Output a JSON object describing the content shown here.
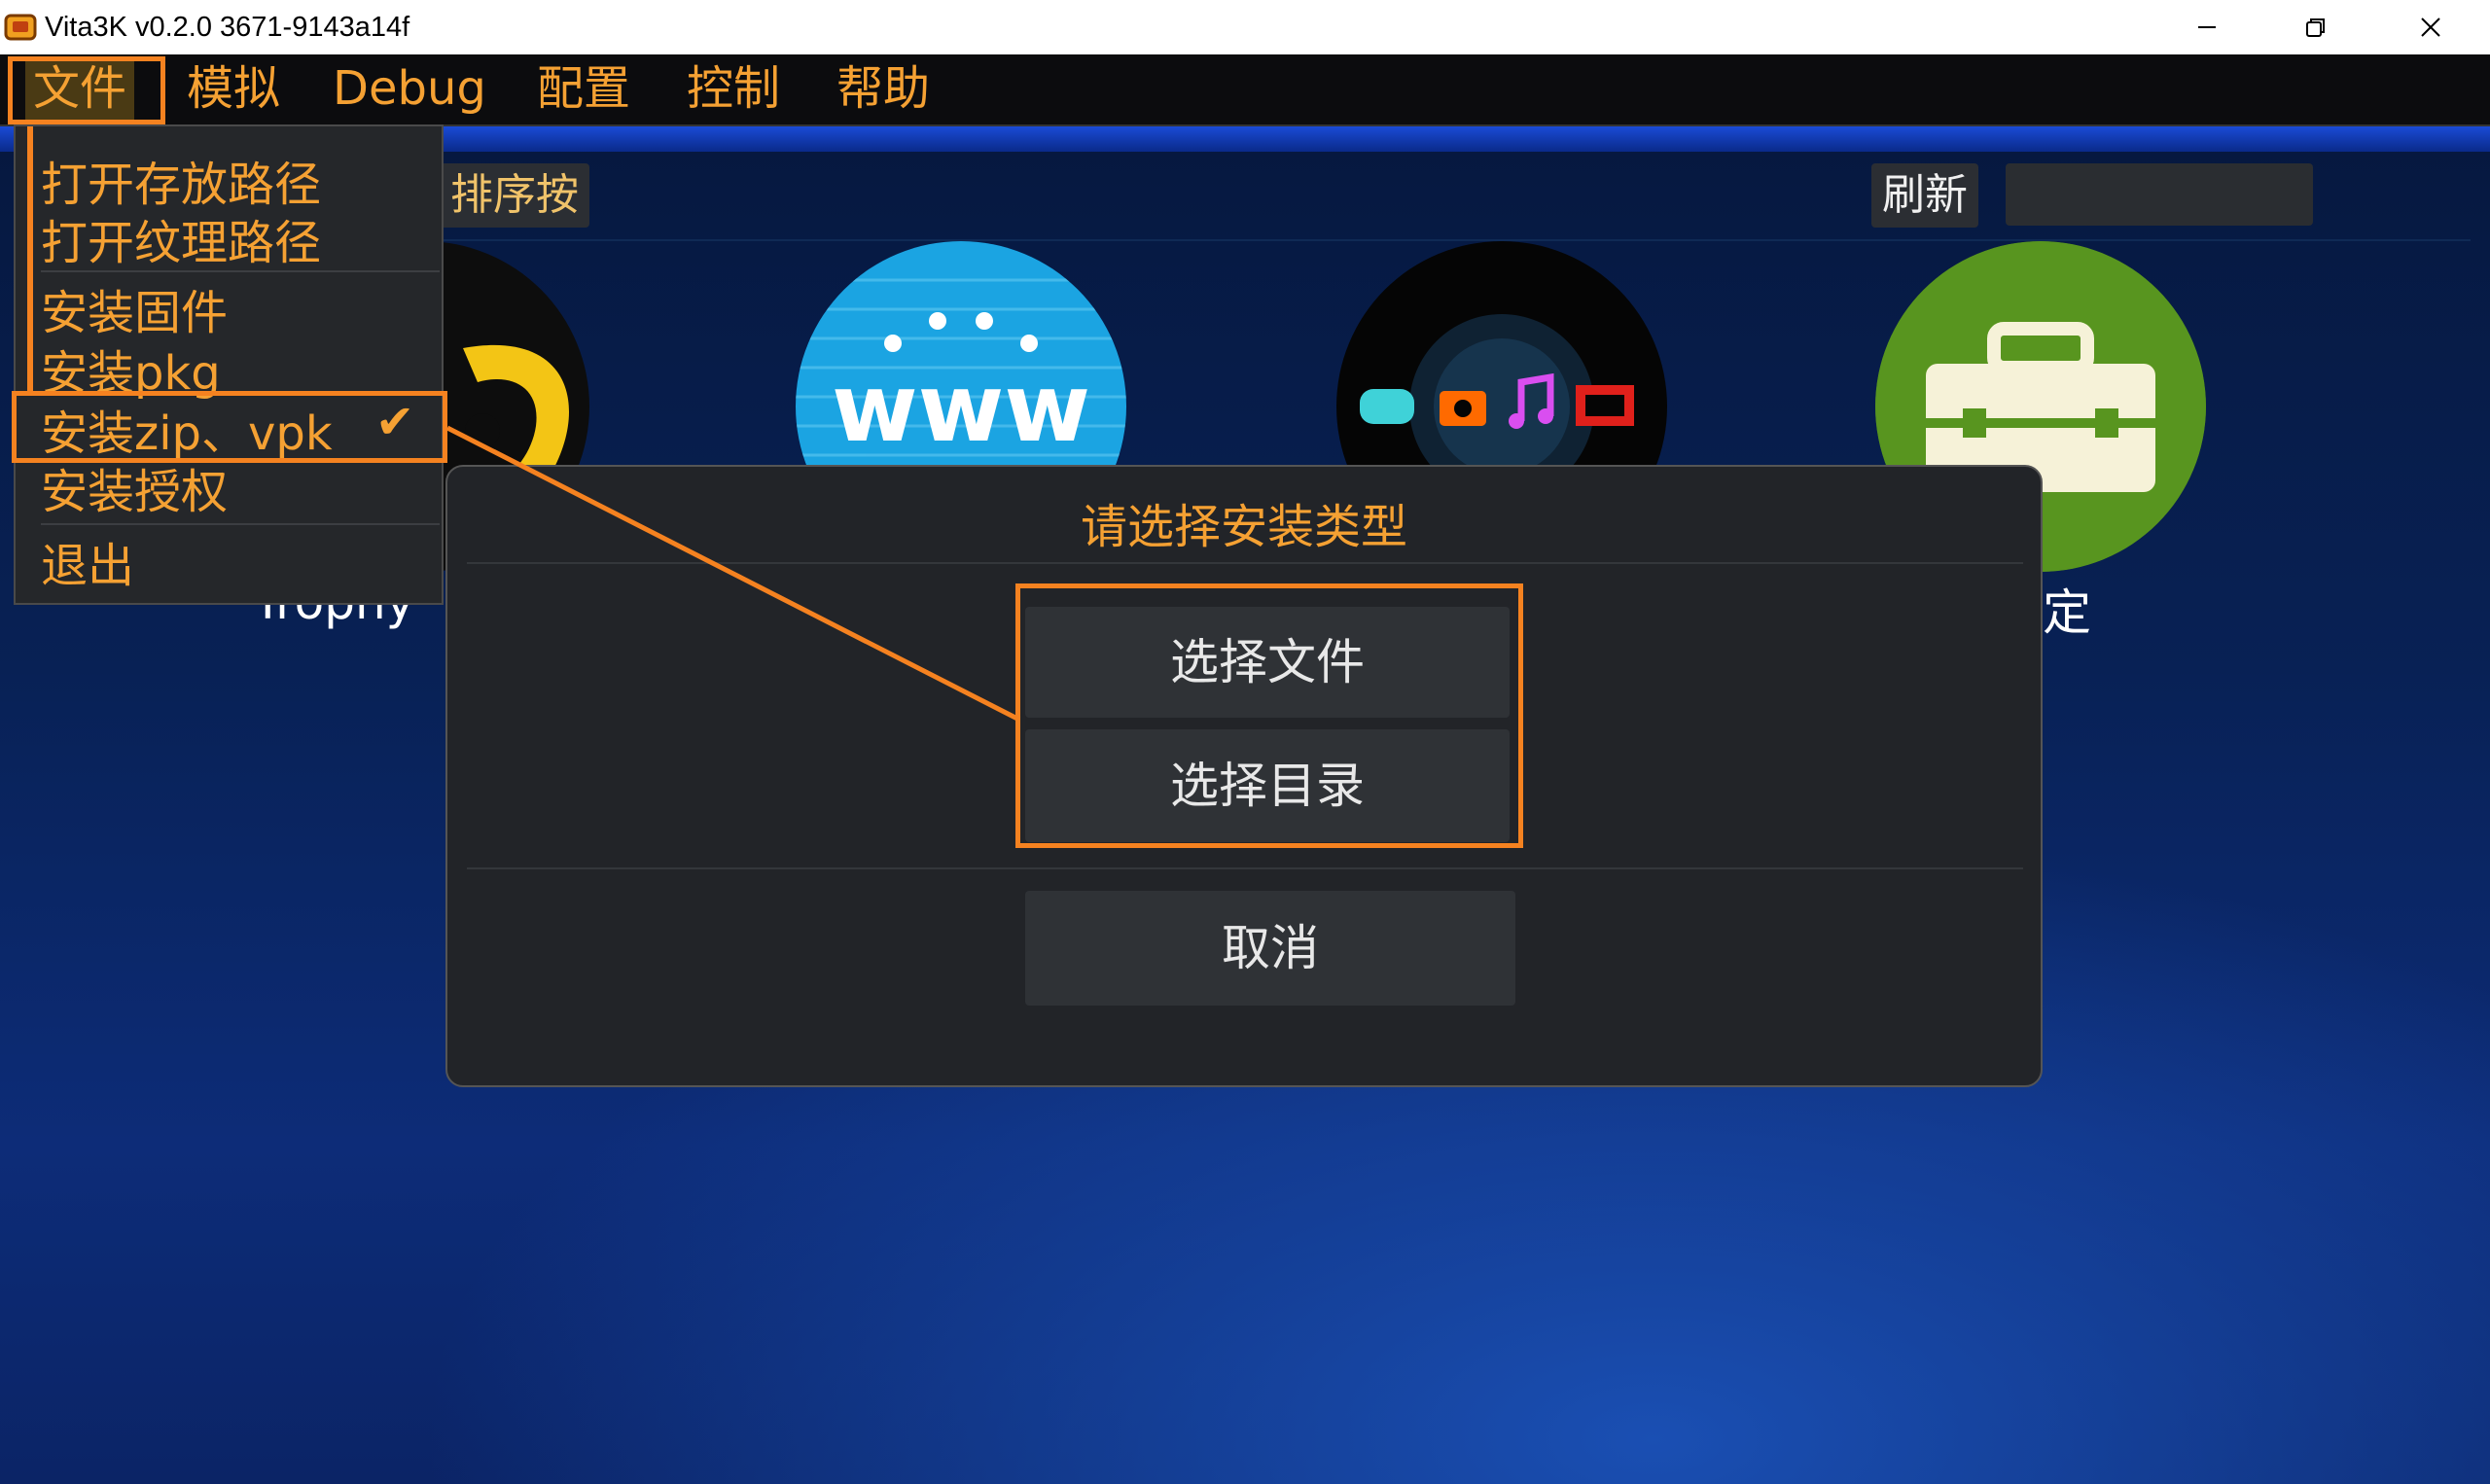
{
  "window": {
    "title": "Vita3K v0.2.0 3671-9143a14f",
    "minimize_glyph": "—",
    "maximize_glyph": "❐",
    "close_glyph": "✕"
  },
  "menubar": {
    "items": [
      {
        "label": "文件"
      },
      {
        "label": "模拟"
      },
      {
        "label": "Debug"
      },
      {
        "label": "配置"
      },
      {
        "label": "控制"
      },
      {
        "label": "帮助"
      }
    ]
  },
  "file_menu": {
    "items": [
      {
        "label": "打开存放路径"
      },
      {
        "label": "打开纹理路径"
      },
      {
        "label": "安装固件"
      },
      {
        "label": "安装pkg"
      },
      {
        "label": "安装zip、vpk",
        "checked": true
      },
      {
        "label": "安装授权"
      },
      {
        "label": "退出"
      }
    ],
    "check_glyph": "✔"
  },
  "app_list": {
    "sort_label": "排序按",
    "refresh_label": "刷新",
    "search_value": "",
    "apps": [
      {
        "label": "Trophy",
        "icon": "trophy-icon"
      },
      {
        "label": "",
        "icon": "browser-www-icon"
      },
      {
        "label": "",
        "icon": "content-manager-icon"
      },
      {
        "label": "定",
        "icon": "settings-toolbox-icon"
      }
    ]
  },
  "install_dialog": {
    "title": "请选择安装类型",
    "choose_file": "选择文件",
    "choose_directory": "选择目录",
    "cancel": "取消"
  },
  "colors": {
    "accent_orange": "#f5a133",
    "highlight": "#f58220",
    "menu_bg": "#0c0c0e",
    "dialog_bg": "#222428"
  }
}
